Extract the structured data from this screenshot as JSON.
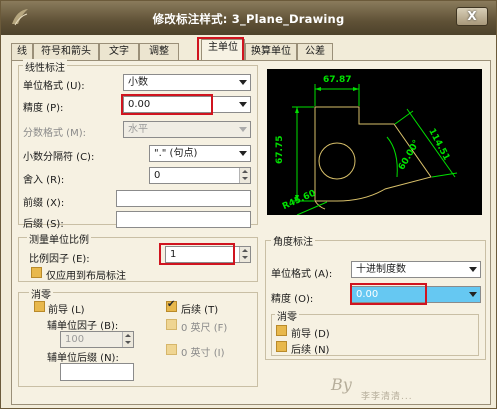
{
  "window": {
    "title": "修改标注样式: 3_Plane_Drawing",
    "close_label": "X"
  },
  "tabs": [
    {
      "label": "线"
    },
    {
      "label": "符号和箭头"
    },
    {
      "label": "文字"
    },
    {
      "label": "调整"
    },
    {
      "label": "主单位"
    },
    {
      "label": "换算单位"
    },
    {
      "label": "公差"
    }
  ],
  "linear": {
    "group_title": "线性标注",
    "unit_format_label": "单位格式 (U):",
    "unit_format_value": "小数",
    "precision_label": "精度 (P):",
    "precision_value": "0.00",
    "fraction_label": "分数格式 (M):",
    "fraction_value": "水平",
    "decimal_sep_label": "小数分隔符 (C):",
    "decimal_sep_value": "\".\" (句点)",
    "roundoff_label": "舍入 (R):",
    "roundoff_value": "0",
    "prefix_label": "前缀 (X):",
    "prefix_value": "",
    "suffix_label": "后缀 (S):",
    "suffix_value": ""
  },
  "scale": {
    "group_title": "测量单位比例",
    "factor_label": "比例因子 (E):",
    "factor_value": "1",
    "layout_only_label": "仅应用到布局标注"
  },
  "zero_linear": {
    "group_title": "消零",
    "leading_label": "前导 (L)",
    "trailing_label": "后续 (T)",
    "sub_unit_factor_label": "辅单位因子 (B):",
    "sub_unit_factor_value": "100",
    "sub_unit_suffix_label": "辅单位后缀 (N):",
    "sub_unit_suffix_value": "",
    "feet_label": "0 英尺 (F)",
    "inches_label": "0 英寸 (I)"
  },
  "angular": {
    "group_title": "角度标注",
    "unit_format_label": "单位格式 (A):",
    "unit_format_value": "十进制度数",
    "precision_label": "精度 (O):",
    "precision_value": "0.00",
    "zero_title": "消零",
    "leading_label": "前导 (D)",
    "trailing_label": "后续 (N)"
  },
  "preview": {
    "dim_top": "67.87",
    "dim_left": "67.75",
    "dim_right": "114.51",
    "dim_angle": "60.00°",
    "dim_radius": "R45.60"
  },
  "colors": {
    "title_bar": "#5f5136",
    "highlight_box": "#d0141f",
    "preview_bg": "#000000",
    "preview_geometry": "#d8c06a",
    "preview_dims": "#00e000"
  },
  "watermark": {
    "signature": "By",
    "text": "李李清清..."
  }
}
